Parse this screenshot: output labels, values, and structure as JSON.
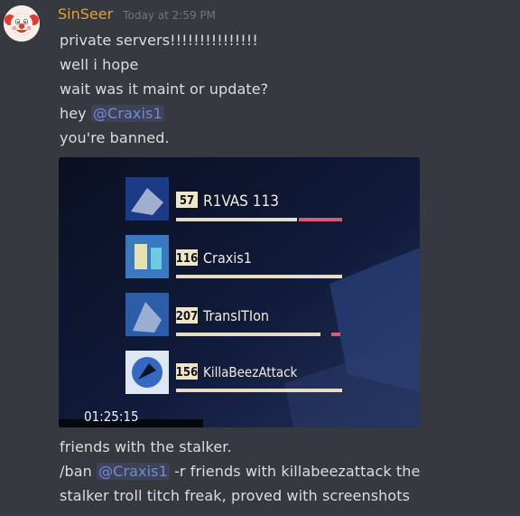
{
  "message": {
    "author": "SinSeer",
    "timestamp": "Today at 2:59 PM",
    "lines": [
      "private servers!!!!!!!!!!!!!!!",
      "well i hope",
      "wait was it maint or update?"
    ],
    "line4_prefix": "hey ",
    "line4_mention": "@Craxis1",
    "line5": "you're banned.",
    "after_image": "friends with the stalker.",
    "line7_prefix": "/ban ",
    "line7_mention": "@Craxis1",
    "line7_suffix": " -r friends with killabeezattack the",
    "line8": "stalker troll titch freak, proved with screenshots"
  },
  "attachment": {
    "video_time": "01:25:15",
    "players": [
      {
        "level": "57",
        "name": "R1VAS 113"
      },
      {
        "level": "116",
        "name": "Craxis1"
      },
      {
        "level": "207",
        "name": "TransITIon"
      },
      {
        "level": "156",
        "name": "KillaBeezAttack"
      }
    ]
  },
  "colors": {
    "background": "#36393f",
    "username": "#e69d3a",
    "mention": "#7289da",
    "text": "#dcddde",
    "timestamp": "#72767d"
  }
}
